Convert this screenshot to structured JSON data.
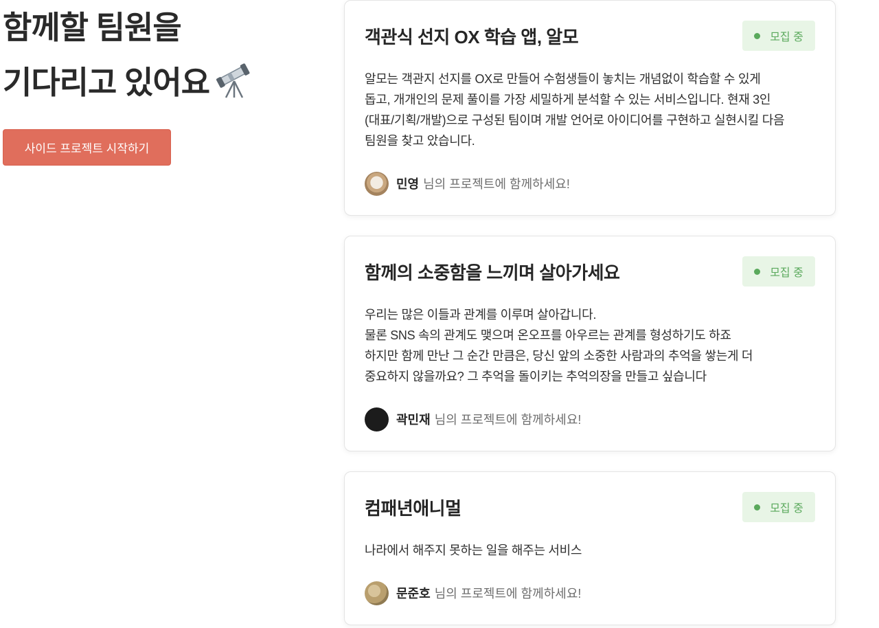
{
  "hero": {
    "title_line1": "함께할 팀원을",
    "title_line2": "기다리고 있어요",
    "start_button": "사이드 프로젝트 시작하기"
  },
  "icons": {
    "telescope": "telescope-icon",
    "status": "status-dot-icon"
  },
  "colors": {
    "accent": "#e06e5c",
    "status_green": "#5aa95c",
    "status_bg": "#e8f5e6"
  },
  "projects": [
    {
      "title": "객관식 선지 OX 학습 앱, 알모",
      "status": "모집 중",
      "description": "알모는 객관지 선지를 OX로 만들어 수험생들이 놓치는 개념없이 학습할 수 있게\n돕고, 개개인의 문제 풀이를 가장 세밀하게 분석할 수 있는 서비스입니다. 현재 3인\n(대표/기획/개발)으로 구성된 팀이며 개발 언어로 아이디어를 구현하고 실현시킬 다음\n팀원을 찾고 았습니다.",
      "author": "민영",
      "author_suffix": "님의 프로젝트에 함께하세요!"
    },
    {
      "title": "함께의 소중함을 느끼며 살아가세요",
      "status": "모집 중",
      "description": "우리는 많은 이들과 관계를 이루며 살아갑니다.\n물론 SNS 속의 관계도 맺으며 온오프를 아우르는 관계를 형성하기도 하죠\n하지만 함께 만난 그 순간 만큼은, 당신 앞의 소중한 사람과의 추억을 쌓는게 더\n중요하지 않을까요? 그 추억을 돌이키는 추억의장을 만들고 싶습니다",
      "author": "곽민재",
      "author_suffix": "님의 프로젝트에 함께하세요!"
    },
    {
      "title": "컴패년애니멀",
      "status": "모집 중",
      "description": "나라에서 해주지 못하는 일을 해주는 서비스",
      "author": "문준호",
      "author_suffix": "님의 프로젝트에 함께하세요!"
    }
  ]
}
